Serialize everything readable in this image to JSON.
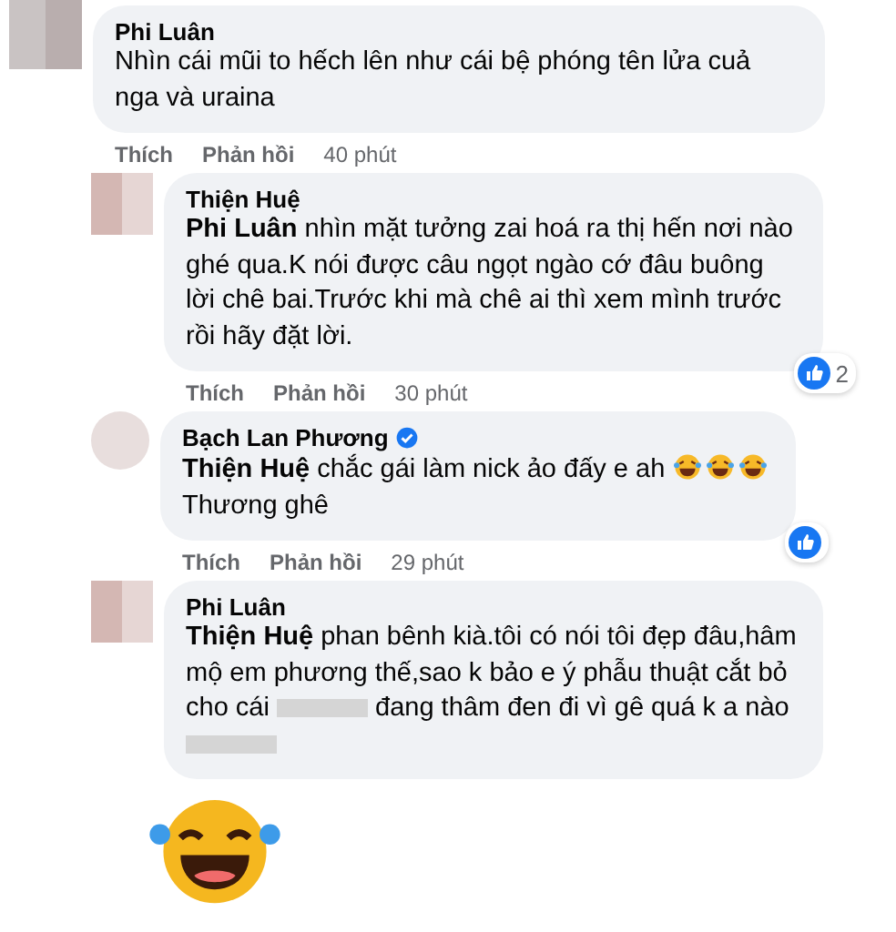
{
  "comments": [
    {
      "author": "Phi Luân",
      "verified": false,
      "body": [
        {
          "kind": "text",
          "text": "Nhìn cái mũi to hếch lên như cái bệ phóng tên lửa cuả nga và uraina"
        }
      ],
      "liked": false,
      "sticker": false,
      "actions": [
        "Thích",
        "Phản hồi"
      ],
      "time": "40 phút",
      "children": [
        {
          "author": "Thiện Huệ",
          "verified": false,
          "body": [
            {
              "kind": "mention",
              "text": "Phi Luân"
            },
            {
              "kind": "text",
              "text": " nhìn mặt tưởng zai hoá ra thị hến nơi nào ghé qua.K nói được câu ngọt ngào cớ đâu buông lời chê bai.Trước khi mà chê ai thì xem mình trước rồi hãy đặt lời."
            }
          ],
          "liked": true,
          "like_count": "2",
          "sticker": false,
          "actions": [
            "Thích",
            "Phản hồi"
          ],
          "time": "30 phút"
        },
        {
          "author": "Bạch Lan Phương",
          "verified": true,
          "body": [
            {
              "kind": "mention",
              "text": "Thiện Huệ"
            },
            {
              "kind": "text",
              "text": " chắc gái làm nick ảo đấy e ah "
            },
            {
              "kind": "emoji"
            },
            {
              "kind": "emoji"
            },
            {
              "kind": "emoji"
            },
            {
              "kind": "break"
            },
            {
              "kind": "text",
              "text": "Thương ghê"
            }
          ],
          "liked": true,
          "sticker": false,
          "actions": [
            "Thích",
            "Phản hồi"
          ],
          "time": "29 phút"
        },
        {
          "author": "Phi Luân",
          "verified": false,
          "body": [
            {
              "kind": "mention",
              "text": "Thiện Huệ"
            },
            {
              "kind": "text",
              "text": " phan bênh kià.tôi có nói tôi đẹp đâu,hâm mộ em phương thế,sao k bảo e ý phẫu thuật cắt bỏ cho cái "
            },
            {
              "kind": "redacted"
            },
            {
              "kind": "text",
              "text": " đang thâm đen đi vì gê quá k a nào "
            },
            {
              "kind": "redacted"
            }
          ],
          "liked": false,
          "sticker": true
        }
      ]
    }
  ]
}
